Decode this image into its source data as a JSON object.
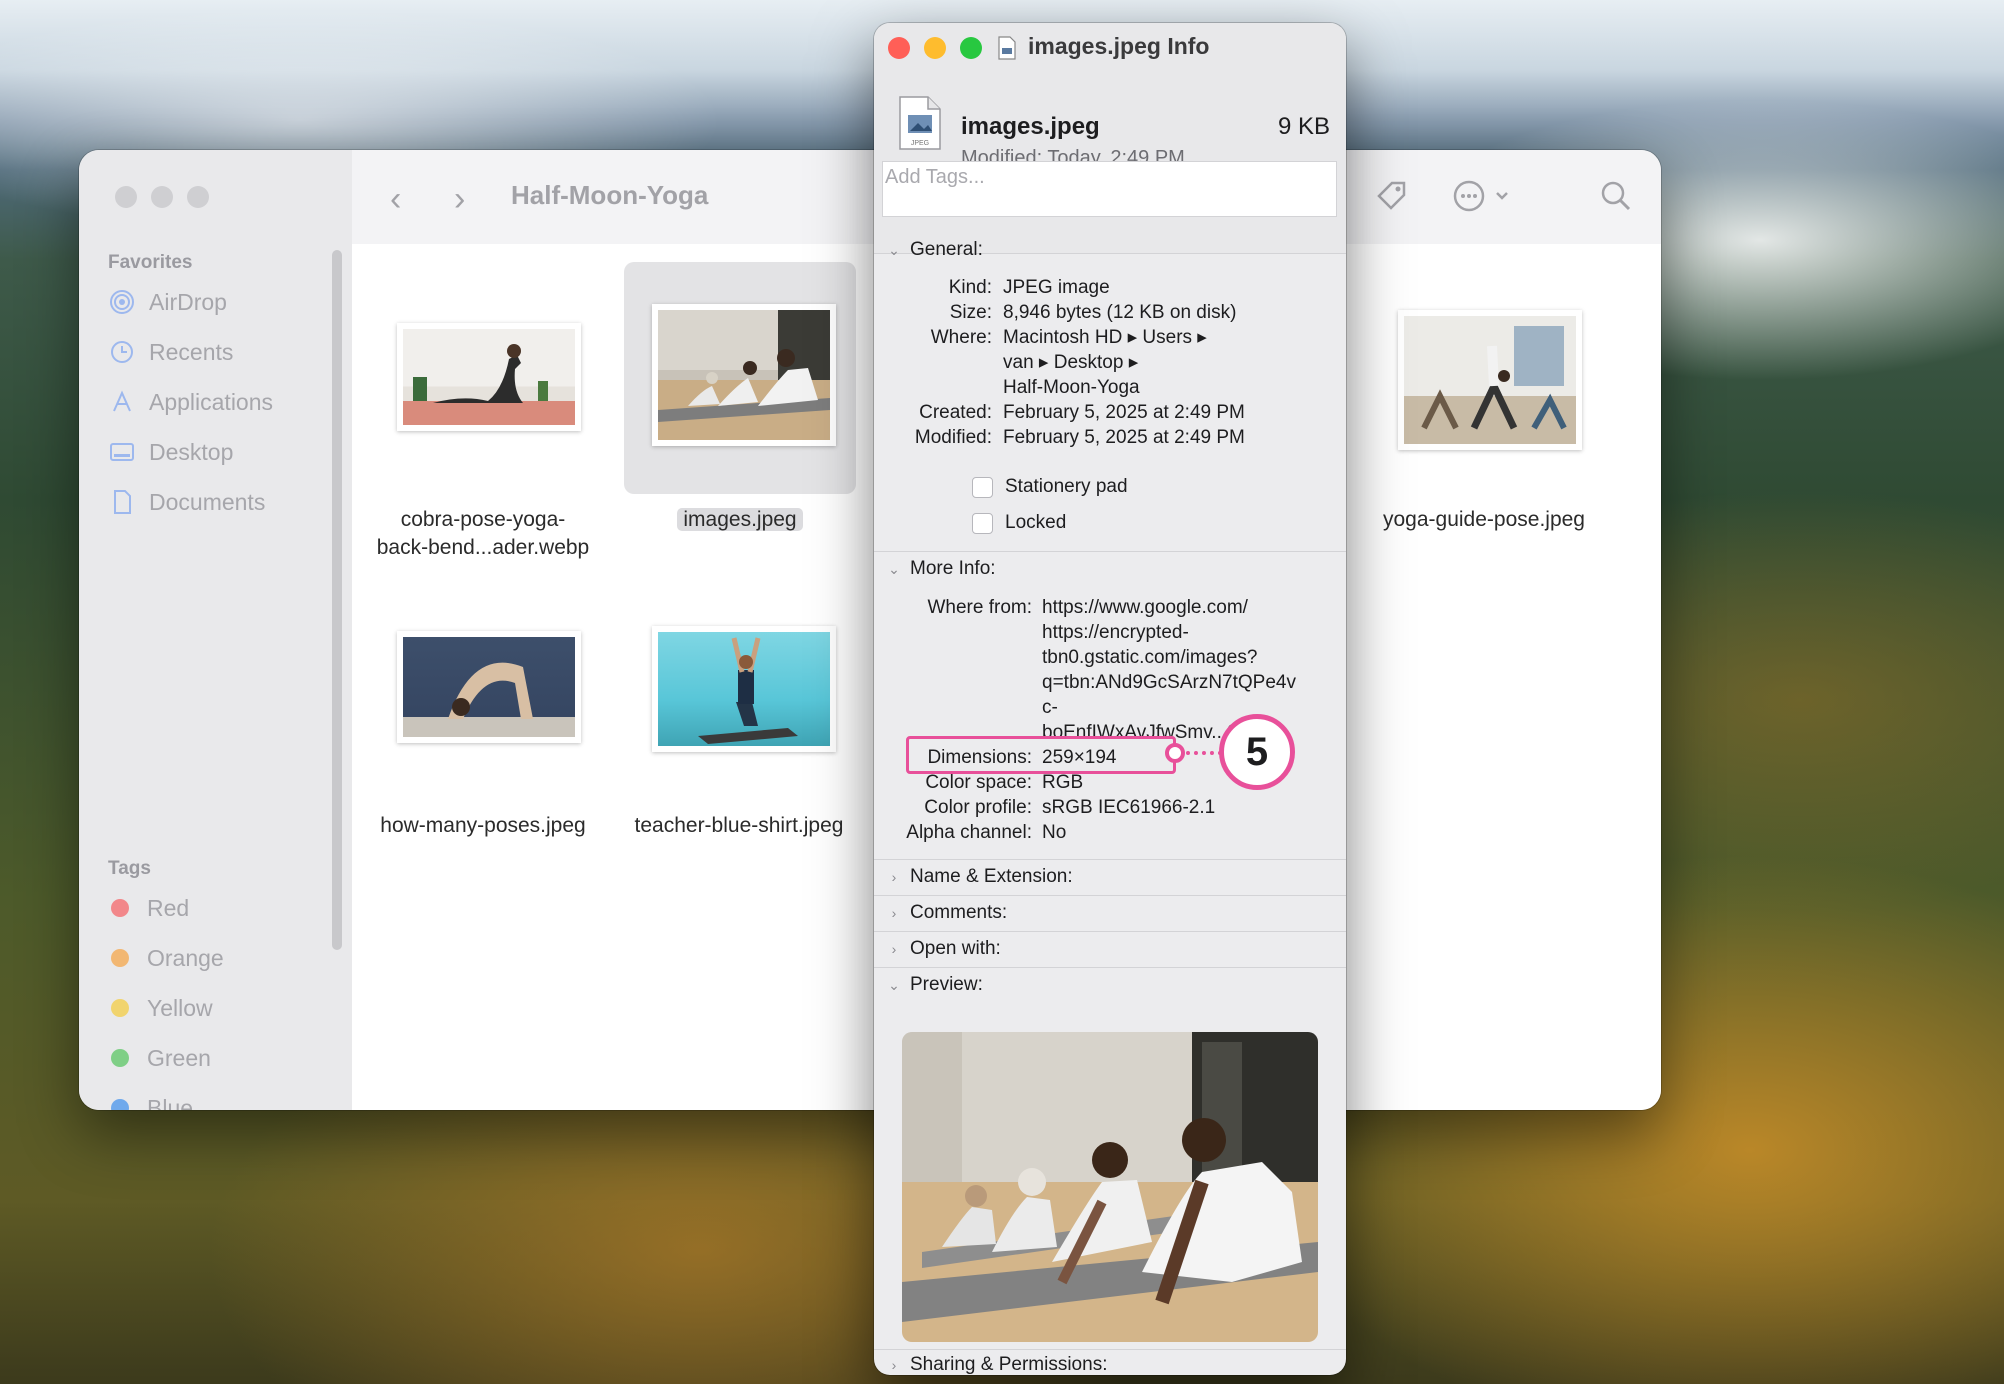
{
  "finder": {
    "title": "Half-Moon-Yoga",
    "nav_back": "‹",
    "nav_forward": "›",
    "sidebar": {
      "favorites_heading": "Favorites",
      "favorites": [
        "AirDrop",
        "Recents",
        "Applications",
        "Desktop",
        "Documents"
      ],
      "tags_heading": "Tags",
      "tags": [
        {
          "label": "Red",
          "color": "#f2878a"
        },
        {
          "label": "Orange",
          "color": "#f2b772"
        },
        {
          "label": "Yellow",
          "color": "#f1d46e"
        },
        {
          "label": "Green",
          "color": "#7fcf86"
        },
        {
          "label": "Blue",
          "color": "#6fa9ec"
        }
      ]
    },
    "files": [
      {
        "name_line1": "cobra-pose-yoga-",
        "name_line2": "back-bend...ader.webp"
      },
      {
        "name_line1": "images.jpeg",
        "name_line2": ""
      },
      {
        "name_line1": "yoga-guide-pose.jpeg",
        "name_line2": ""
      },
      {
        "name_line1": "how-many-poses.jpeg",
        "name_line2": ""
      },
      {
        "name_line1": "teacher-blue-shirt.jpeg",
        "name_line2": ""
      }
    ]
  },
  "info": {
    "window_title": "images.jpeg Info",
    "file_name": "images.jpeg",
    "file_size": "9 KB",
    "modified_label": "Modified:",
    "modified_value": "Today, 2:49 PM",
    "tags_placeholder": "Add Tags...",
    "general": {
      "heading": "General:",
      "kind_label": "Kind:",
      "kind_value": "JPEG image",
      "size_label": "Size:",
      "size_value": "8,946 bytes (12 KB on disk)",
      "where_label": "Where:",
      "where_line1": "Macintosh HD ▸ Users ▸",
      "where_line2": "van ▸ Desktop ▸",
      "where_line3": "Half-Moon-Yoga",
      "created_label": "Created:",
      "created_value": "February 5, 2025 at 2:49 PM",
      "modified_label": "Modified:",
      "modified_value": "February 5, 2025 at 2:49 PM",
      "stationery_label": "Stationery pad",
      "locked_label": "Locked"
    },
    "more_info": {
      "heading": "More Info:",
      "where_from_label": "Where from:",
      "where_from_lines": [
        "https://www.google.com/",
        "https://encrypted-",
        "tbn0.gstatic.com/images?",
        "q=tbn:ANd9GcSArzN7tQPe4v",
        "c-",
        "boEnfIWxAvJfwSmv...9&s"
      ],
      "dimensions_label": "Dimensions:",
      "dimensions_value": "259×194",
      "color_space_label": "Color space:",
      "color_space_value": "RGB",
      "color_profile_label": "Color profile:",
      "color_profile_value": "sRGB IEC61966-2.1",
      "alpha_label": "Alpha channel:",
      "alpha_value": "No"
    },
    "sections": {
      "name_ext": "Name & Extension:",
      "comments": "Comments:",
      "open_with": "Open with:",
      "preview": "Preview:",
      "sharing": "Sharing & Permissions:"
    }
  },
  "callout": {
    "number": "5",
    "color": "#e8509a"
  }
}
